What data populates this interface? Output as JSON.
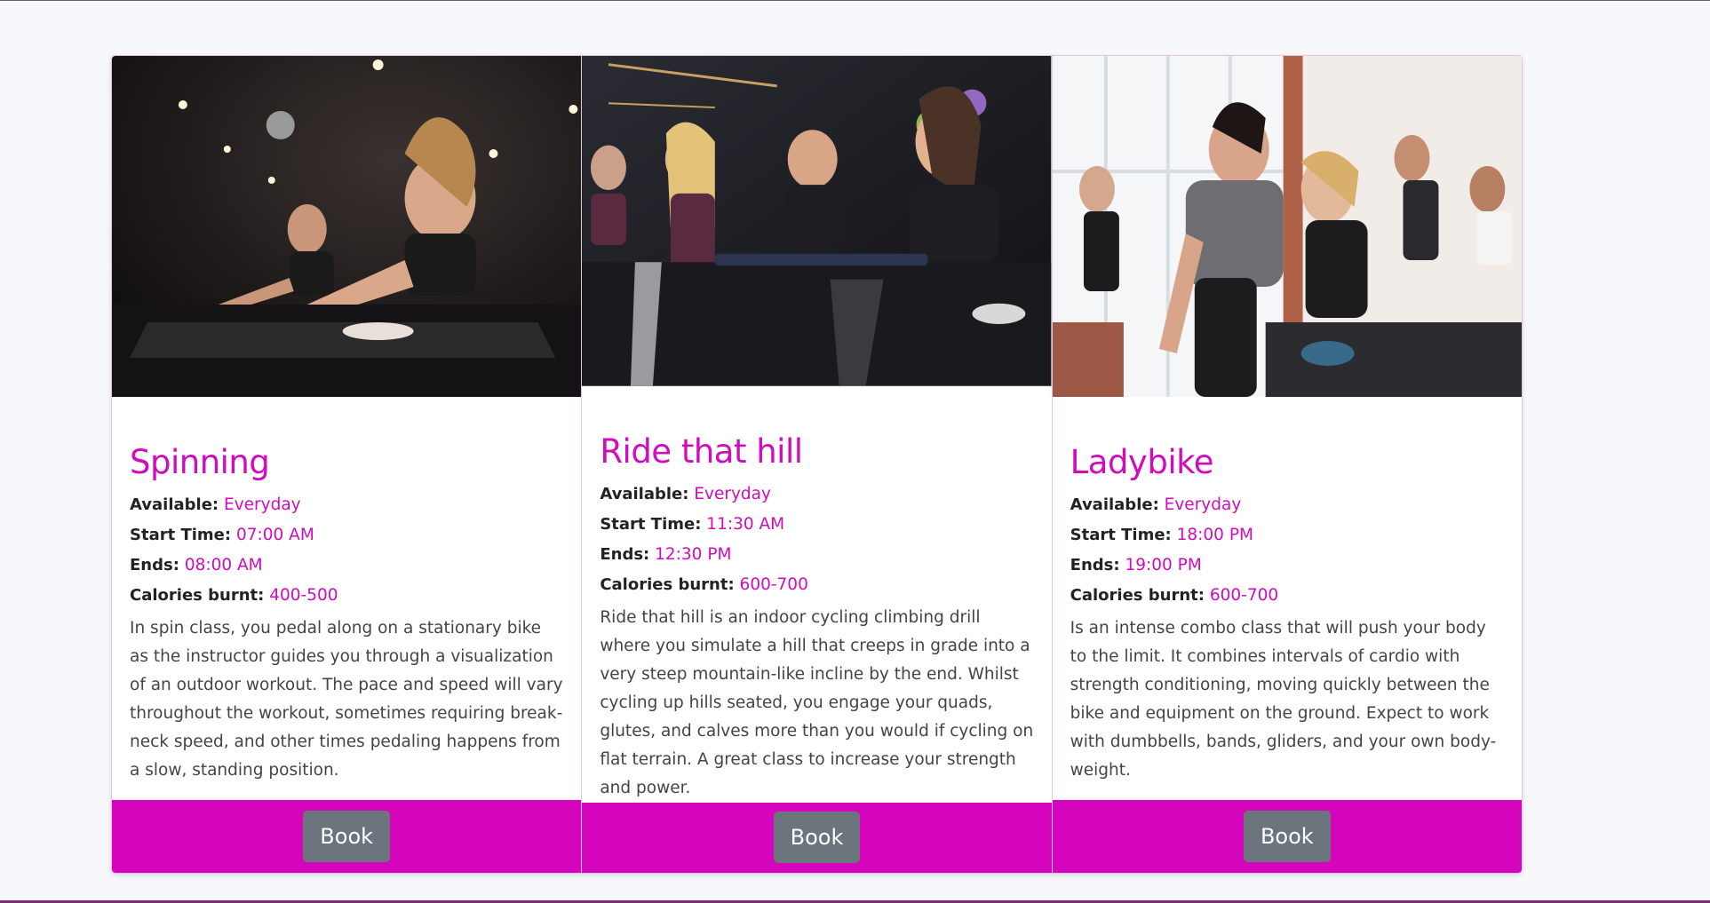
{
  "labels": {
    "available": "Available:",
    "start": "Start Time:",
    "ends": "Ends:",
    "calories": "Calories burnt:"
  },
  "classes": [
    {
      "title": "Spinning",
      "available": "Everyday",
      "start": "07:00 AM",
      "ends": "08:00 AM",
      "calories": "400-500",
      "description": "In spin class, you pedal along on a stationary bike as the instructor guides you through a visualization of an outdoor workout. The pace and speed will vary throughout the workout, sometimes requiring break-neck speed, and other times pedaling happens from a slow, standing position.",
      "button": "Book"
    },
    {
      "title": "Ride that hill",
      "available": "Everyday",
      "start": "11:30 AM",
      "ends": "12:30 PM",
      "calories": "600-700",
      "description": "Ride that hill is an indoor cycling climbing drill where you simulate a hill that creeps in grade into a very steep mountain-like incline by the end. Whilst cycling up hills seated, you engage your quads, glutes, and calves more than you would if cycling on flat terrain. A great class to increase your strength and power.",
      "button": "Book"
    },
    {
      "title": "Ladybike",
      "available": "Everyday",
      "start": "18:00 PM",
      "ends": "19:00 PM",
      "calories": "600-700",
      "description": "Is an intense combo class that will push your body to the limit. It combines intervals of cardio with strength conditioning, moving quickly between the bike and equipment on the ground. Expect to work with dumbbells, bands, gliders, and your own body-weight.",
      "button": "Book"
    }
  ],
  "colors": {
    "accent": "#d10cbc",
    "footer": "#d405bd",
    "button": "#6c757d"
  }
}
